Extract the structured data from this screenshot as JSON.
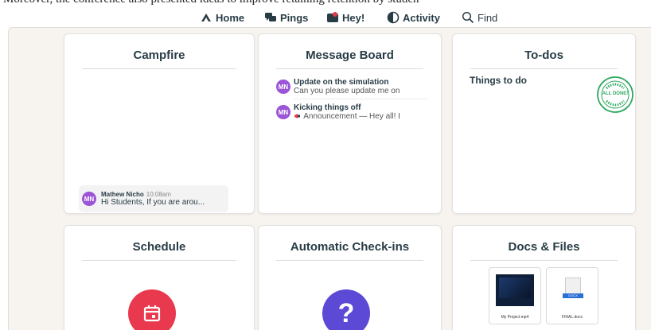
{
  "top_text": "Moreover, the conference also presented ideas to improve retaining retention by studen",
  "nav": {
    "home": "Home",
    "pings": "Pings",
    "hey": "Hey!",
    "activity": "Activity",
    "find": "Find"
  },
  "cards": {
    "campfire": {
      "title": "Campfire",
      "message": {
        "avatar": "MN",
        "author": "Mathew Nicho",
        "time": "10:08am",
        "text": "Hi Students, If you are arou..."
      }
    },
    "message_board": {
      "title": "Message Board",
      "items": [
        {
          "avatar": "MN",
          "title": "Update on the simulation",
          "subtitle": "Can you please update me on"
        },
        {
          "avatar": "MN",
          "title": "Kicking things off",
          "subtitle": "Announcement — Hey all! I"
        }
      ]
    },
    "todos": {
      "title": "To-dos",
      "list_name": "Things to do",
      "stamp_text": "ALL DONE!"
    },
    "schedule": {
      "title": "Schedule"
    },
    "checkins": {
      "title": "Automatic Check-ins",
      "icon_glyph": "?"
    },
    "docs": {
      "title": "Docs & Files",
      "files": [
        {
          "name": "My Project.mp4"
        },
        {
          "name": "FINAL.docx",
          "badge": "DOCX"
        }
      ]
    }
  },
  "colors": {
    "avatar": "#9b55d6",
    "schedule_icon": "#e8394e",
    "checkins_icon": "#5c49d6",
    "stamp": "#2fa95f"
  }
}
